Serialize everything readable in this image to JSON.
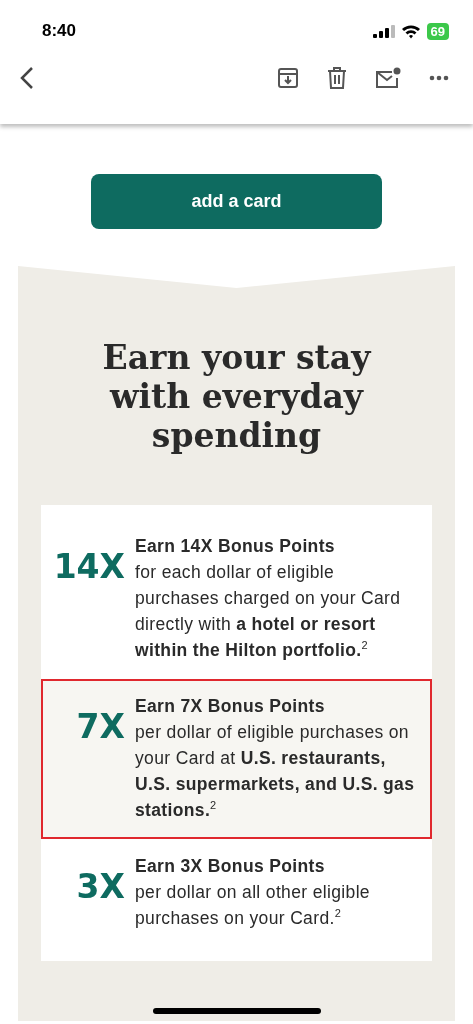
{
  "status_bar": {
    "time": "8:40",
    "battery": "69"
  },
  "add_button": "add a card",
  "heading": "Earn your stay with everyday spending",
  "offers": [
    {
      "multiplier": "14X",
      "title": "Earn 14X Bonus Points",
      "text": "for each dollar of eligible purchases charged on your Card directly with **a hotel or resort within the Hilton portfolio.**$^{2}$",
      "highlighted": false
    },
    {
      "multiplier": "7X",
      "title": "Earn 7X Bonus Points",
      "text": "per dollar of eligible purchases on your Card at **U.S. restaurants, U.S. supermarkets, and U.S. gas stations.**$^{2}$",
      "highlighted": true
    },
    {
      "multiplier": "3X",
      "title": "Earn 3X Bonus Points",
      "text": "per dollar on all other eligible purchases on your Card.$^{2}$",
      "highlighted": false
    }
  ]
}
